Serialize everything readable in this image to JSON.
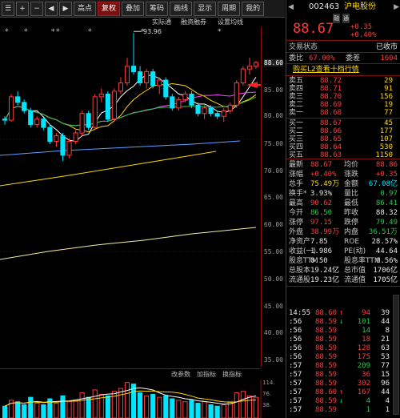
{
  "toolbar": {
    "items": [
      "高点",
      "复权",
      "叠加",
      "筹码",
      "画线",
      "显示",
      "周期",
      "我的"
    ],
    "active_index": 1,
    "icons": [
      "bars-icon",
      "plus-icon",
      "minus-icon",
      "left-arrow-icon",
      "right-arrow-icon"
    ]
  },
  "subbar": {
    "items": [
      "实际通",
      "融资融券",
      "设置均线"
    ]
  },
  "chart_annotation": "93.96",
  "axis_prices": [
    "88.60",
    "85.00",
    "80.00",
    "75.00",
    "70.00",
    "65.00",
    "60.00",
    "55.00",
    "50.00",
    "45.00",
    "40.00",
    "35.00"
  ],
  "indicator_tabs": [
    "改参数",
    "加指标",
    "换指标"
  ],
  "vol_axis": [
    "114.",
    "76.",
    "38."
  ],
  "chart_data": {
    "type": "candlestick",
    "candles": [
      [
        78.5,
        79.0,
        77.5,
        78.3
      ],
      [
        78.3,
        83.0,
        78.0,
        82.5
      ],
      [
        82.5,
        83.5,
        81.0,
        81.5
      ],
      [
        81.5,
        82.0,
        79.5,
        80.0
      ],
      [
        80.0,
        80.5,
        77.0,
        77.5
      ],
      [
        77.5,
        79.0,
        77.0,
        78.5
      ],
      [
        78.5,
        78.8,
        76.5,
        77.0
      ],
      [
        77.0,
        77.5,
        74.0,
        74.5
      ],
      [
        74.5,
        76.0,
        73.5,
        75.5
      ],
      [
        75.5,
        76.0,
        71.0,
        72.0
      ],
      [
        72.0,
        75.0,
        71.5,
        74.5
      ],
      [
        74.5,
        76.5,
        74.0,
        76.0
      ],
      [
        76.0,
        80.0,
        75.5,
        79.5
      ],
      [
        79.5,
        80.0,
        76.5,
        77.0
      ],
      [
        77.0,
        83.0,
        76.5,
        82.5
      ],
      [
        82.5,
        84.0,
        81.5,
        83.0
      ],
      [
        83.0,
        83.5,
        78.0,
        78.5
      ],
      [
        78.5,
        84.0,
        78.0,
        83.5
      ],
      [
        83.5,
        86.0,
        83.0,
        85.0
      ],
      [
        85.0,
        89.5,
        84.5,
        88.0
      ],
      [
        88.0,
        93.96,
        86.5,
        87.0
      ],
      [
        87.0,
        88.0,
        84.5,
        85.0
      ],
      [
        85.0,
        87.5,
        84.0,
        87.0
      ],
      [
        87.0,
        87.5,
        84.0,
        84.5
      ],
      [
        84.5,
        86.0,
        83.0,
        85.5
      ],
      [
        85.5,
        86.0,
        82.0,
        82.5
      ],
      [
        82.5,
        83.0,
        80.0,
        80.5
      ],
      [
        80.5,
        82.5,
        80.0,
        82.0
      ],
      [
        82.0,
        83.5,
        81.5,
        83.0
      ],
      [
        83.0,
        83.5,
        80.5,
        81.0
      ],
      [
        81.0,
        81.5,
        79.0,
        79.5
      ],
      [
        79.5,
        81.0,
        78.5,
        80.5
      ],
      [
        80.5,
        81.0,
        79.0,
        79.5
      ],
      [
        79.5,
        80.0,
        78.5,
        79.0
      ],
      [
        79.0,
        80.5,
        78.0,
        80.0
      ],
      [
        80.0,
        81.5,
        79.5,
        81.0
      ],
      [
        81.0,
        85.5,
        80.5,
        85.0
      ],
      [
        85.0,
        88.0,
        84.5,
        87.5
      ],
      [
        87.5,
        89.5,
        86.5,
        88.0
      ],
      [
        88.0,
        89.0,
        87.5,
        88.67
      ]
    ],
    "volumes": [
      40,
      60,
      55,
      45,
      70,
      50,
      45,
      65,
      50,
      75,
      55,
      60,
      85,
      70,
      95,
      80,
      75,
      90,
      100,
      120,
      115,
      85,
      75,
      80,
      70,
      75,
      65,
      60,
      55,
      60,
      50,
      55,
      45,
      40,
      45,
      55,
      85,
      90,
      75,
      70
    ],
    "ylim": [
      34,
      95
    ],
    "vol_ylim": [
      0,
      130
    ],
    "colors": {
      "up": "#ff3b3b",
      "down": "#00e5ff",
      "ma5": "#ffffff",
      "ma10": "#ffd700",
      "ma20": "#ff44ff",
      "ma60": "#22cc44",
      "ma120": "#5aa0ff",
      "ma250": "#ffd700"
    }
  },
  "right": {
    "header": {
      "code": "002463",
      "name": "沪电股份",
      "tags": [
        "融",
        "通"
      ]
    },
    "price": "88.67",
    "change": "+0.35",
    "change_pct": "+0.40%",
    "status_label": "交易状态",
    "status_value": "已收市",
    "ratio_label": "委比",
    "ratio_value": "67.00%",
    "diff_label": "委差",
    "diff_value": "1604",
    "l2_banner": "购买L2查看十档行情",
    "asks": [
      {
        "label": "卖五",
        "price": "88.72",
        "vol": "29"
      },
      {
        "label": "卖四",
        "price": "88.71",
        "vol": "91"
      },
      {
        "label": "卖三",
        "price": "88.70",
        "vol": "156"
      },
      {
        "label": "卖二",
        "price": "88.69",
        "vol": "19"
      },
      {
        "label": "卖一",
        "price": "88.68",
        "vol": "77"
      }
    ],
    "bids": [
      {
        "label": "买一",
        "price": "88.67",
        "vol": "45"
      },
      {
        "label": "买二",
        "price": "88.66",
        "vol": "177"
      },
      {
        "label": "买三",
        "price": "88.65",
        "vol": "107"
      },
      {
        "label": "买四",
        "price": "88.64",
        "vol": "530"
      },
      {
        "label": "买五",
        "price": "88.63",
        "vol": "1150"
      }
    ],
    "stats": [
      {
        "l1": "最新",
        "v1": "88.67",
        "c1": "red",
        "l2": "均价",
        "v2": "88.86",
        "c2": "red"
      },
      {
        "l1": "涨幅",
        "v1": "+0.40%",
        "c1": "red",
        "l2": "涨跌",
        "v2": "+0.35",
        "c2": "red"
      },
      {
        "l1": "总手",
        "v1": "75.49万",
        "c1": "yellow",
        "l2": "金额",
        "v2": "67.08亿",
        "c2": "cyan"
      },
      {
        "l1": "换手*",
        "v1": "3.93%",
        "c1": "white",
        "l2": "量比",
        "v2": "0.97",
        "c2": "green"
      },
      {
        "l1": "最高",
        "v1": "90.62",
        "c1": "red",
        "l2": "最低",
        "v2": "86.41",
        "c2": "green"
      },
      {
        "l1": "今开",
        "v1": "86.50",
        "c1": "green",
        "l2": "昨收",
        "v2": "88.32",
        "c2": "white"
      },
      {
        "l1": "涨停",
        "v1": "97.15",
        "c1": "red",
        "l2": "跌停",
        "v2": "79.49",
        "c2": "green"
      },
      {
        "l1": "外盘",
        "v1": "38.99万",
        "c1": "red",
        "l2": "内盘",
        "v2": "36.51万",
        "c2": "green"
      },
      {
        "l1": "净资产",
        "v1": "7.85",
        "c1": "white",
        "l2": "ROE",
        "v2": "28.57%",
        "c2": "white"
      },
      {
        "l1": "收益(一)",
        "v1": "1.986",
        "c1": "white",
        "l2": "PE(动)",
        "v2": "44.64",
        "c2": "white"
      },
      {
        "l1": "股息TTM",
        "v1": "0.50",
        "c1": "white",
        "l2": "股息率TTM",
        "v2": "0.56%",
        "c2": "white"
      },
      {
        "l1": "总股本",
        "v1": "19.24亿",
        "c1": "white",
        "l2": "总市值",
        "v2": "1706亿",
        "c2": "white"
      },
      {
        "l1": "流通股",
        "v1": "19.23亿",
        "c1": "white",
        "l2": "流通值",
        "v2": "1705亿",
        "c2": "white"
      }
    ],
    "ticks": [
      {
        "time": "14:55",
        "price": "88.60",
        "arrow": "up",
        "vol": "94",
        "n": "39",
        "vc": "red"
      },
      {
        "time": ":56",
        "price": "88.59",
        "arrow": "down",
        "vol": "101",
        "n": "44",
        "vc": "green"
      },
      {
        "time": ":56",
        "price": "88.59",
        "arrow": "",
        "vol": "14",
        "n": "8",
        "vc": "green"
      },
      {
        "time": ":56",
        "price": "88.59",
        "arrow": "",
        "vol": "18",
        "n": "21",
        "vc": "red"
      },
      {
        "time": ":56",
        "price": "88.59",
        "arrow": "",
        "vol": "128",
        "n": "63",
        "vc": "red"
      },
      {
        "time": ":56",
        "price": "88.59",
        "arrow": "",
        "vol": "175",
        "n": "53",
        "vc": "red"
      },
      {
        "time": ":57",
        "price": "88.59",
        "arrow": "",
        "vol": "209",
        "n": "77",
        "vc": "green"
      },
      {
        "time": ":57",
        "price": "88.59",
        "arrow": "",
        "vol": "36",
        "n": "15",
        "vc": "red"
      },
      {
        "time": ":57",
        "price": "88.59",
        "arrow": "",
        "vol": "302",
        "n": "96",
        "vc": "red"
      },
      {
        "time": ":57",
        "price": "88.60",
        "arrow": "up",
        "vol": "167",
        "n": "44",
        "vc": "red"
      },
      {
        "time": ":57",
        "price": "88.59",
        "arrow": "down",
        "vol": "4",
        "n": "4",
        "vc": "green"
      },
      {
        "time": ":57",
        "price": "88.59",
        "arrow": "",
        "vol": "1",
        "n": "1",
        "vc": "green"
      }
    ]
  }
}
